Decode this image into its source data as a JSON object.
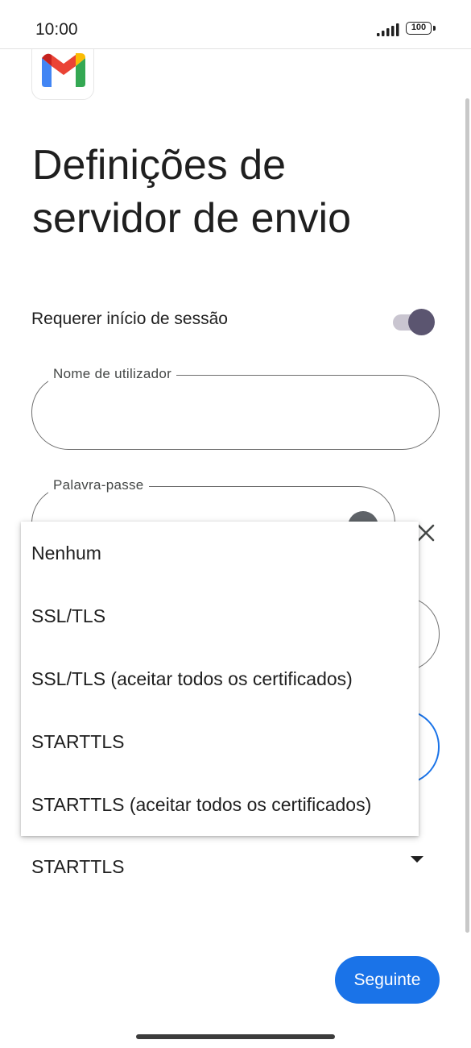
{
  "status_bar": {
    "time": "10:00",
    "battery": "100",
    "icons": [
      "signal-icon",
      "battery-icon"
    ]
  },
  "logo": {
    "icon": "gmail-logo-icon",
    "colors": [
      "#4285f4",
      "#ea4335",
      "#fbbc04",
      "#34a853",
      "#c5221f"
    ]
  },
  "page": {
    "title_line_1": "Definições de",
    "title_line_2": "servidor de envio"
  },
  "require_login": {
    "label": "Requerer início de sessão",
    "enabled": true
  },
  "username_field": {
    "label": "Nome de utilizador",
    "value": ""
  },
  "password_field": {
    "label": "Palavra-passe",
    "value": "",
    "icons": [
      "visibility-icon",
      "clear-icon"
    ]
  },
  "security_select": {
    "selected": "STARTTLS",
    "options": [
      "Nenhum",
      "SSL/TLS",
      "SSL/TLS (aceitar todos os certificados)",
      "STARTTLS",
      "STARTTLS (aceitar todos os certificados)"
    ]
  },
  "footer": {
    "next_label": "Seguinte"
  },
  "colors": {
    "accent": "#1a73e8",
    "toggle_thumb": "#5b5570",
    "toggle_track": "#c9c5d0"
  }
}
